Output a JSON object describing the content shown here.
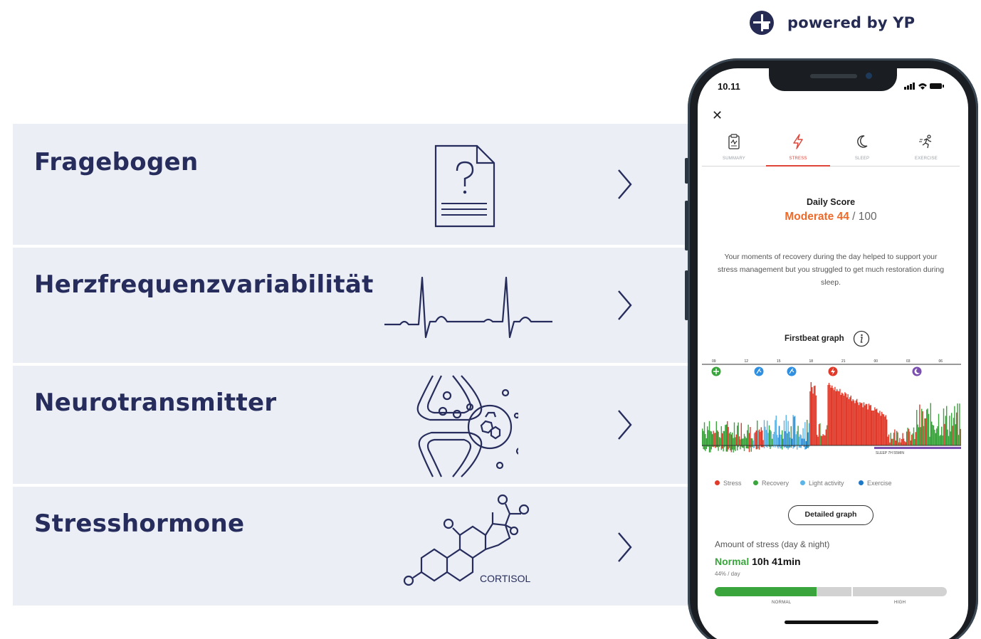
{
  "brand": {
    "text": "powered by YP"
  },
  "list": {
    "items": [
      {
        "title": "Fragebogen",
        "icon": "questionnaire-icon"
      },
      {
        "title": "Herzfrequenzvariabilität",
        "icon": "heartbeat-icon"
      },
      {
        "title": "Neurotransmitter",
        "icon": "synapse-icon"
      },
      {
        "title": "Stresshormone",
        "icon": "cortisol-molecule-icon"
      }
    ],
    "cortisol_label": "CORTISOL",
    "row_color": "#eceef5",
    "title_color": "#262d5c"
  },
  "phone": {
    "status_time": "10.11",
    "tabs": [
      {
        "label": "SUMMARY",
        "icon": "clipboard-icon",
        "active": false
      },
      {
        "label": "STRESS",
        "icon": "lightning-icon",
        "active": true
      },
      {
        "label": "SLEEP",
        "icon": "moon-icon",
        "active": false
      },
      {
        "label": "EXERCISE",
        "icon": "running-icon",
        "active": false
      }
    ],
    "daily_score": {
      "title": "Daily Score",
      "level": "Moderate",
      "value": "44",
      "separator": "/",
      "max": "100"
    },
    "description": "Your moments of recovery during the day helped to support your stress management but you struggled to get much restoration during sleep.",
    "graph_title": "Firstbeat graph",
    "graph": {
      "hours": [
        "09",
        "12",
        "15",
        "18",
        "21",
        "00",
        "03",
        "06"
      ],
      "sleep_label": "SLEEP 7H 55MIN",
      "event_icons": [
        "plus-icon",
        "running-icon",
        "running-icon",
        "lightning-icon",
        "moon-icon"
      ]
    },
    "legend": [
      {
        "label": "Stress",
        "color": "#e23a2a"
      },
      {
        "label": "Recovery",
        "color": "#3aa53c"
      },
      {
        "label": "Light activity",
        "color": "#5ab4e8"
      },
      {
        "label": "Exercise",
        "color": "#1e78c8"
      }
    ],
    "detail_button": "Detailed graph",
    "amount": {
      "title": "Amount of stress (day & night)",
      "level": "Normal",
      "value": "10h 41min",
      "sub": "44% / day",
      "fill_percent": 44,
      "label_normal": "NORMAL",
      "label_high": "HIGH"
    },
    "accent_color": "#e0453a",
    "score_color": "#ee6a2a"
  }
}
